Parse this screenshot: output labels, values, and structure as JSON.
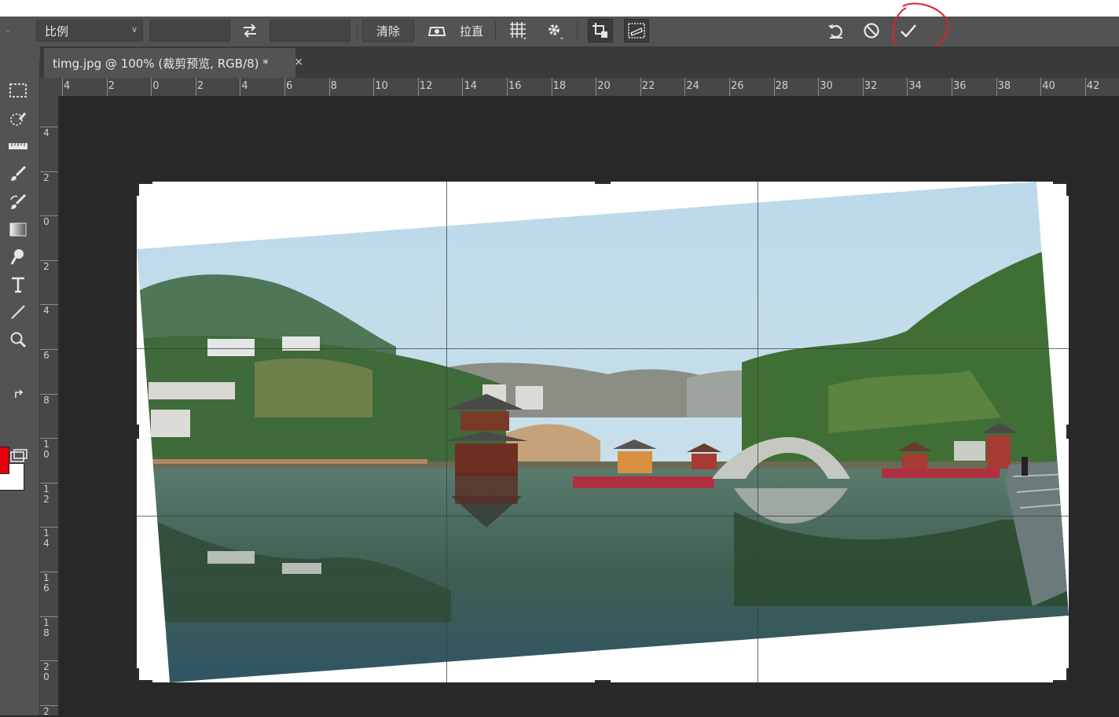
{
  "options_bar": {
    "ratio_label": "比例",
    "clear_label": "清除",
    "straighten_label": "拉直"
  },
  "document_tab": {
    "title": "timg.jpg @ 100% (裁剪预览, RGB/8) *",
    "close_glyph": "×"
  },
  "ruler_h": [
    "4",
    "2",
    "0",
    "2",
    "4",
    "6",
    "8",
    "10",
    "12",
    "14",
    "16",
    "18",
    "20",
    "22",
    "24",
    "26",
    "28",
    "30",
    "32",
    "34",
    "36",
    "38",
    "40",
    "42"
  ],
  "ruler_v": [
    "4",
    "2",
    "0",
    "2",
    "4",
    "6",
    "8",
    "10",
    "12",
    "14",
    "16",
    "18",
    "20",
    "2"
  ],
  "colors": {
    "foreground": "#e8000a",
    "background": "#ffffff",
    "annotation": "#e0202a"
  },
  "icons": [
    "swap-icon",
    "level-icon",
    "grid-overlay-icon",
    "settings-gear-icon",
    "delete-cropped-icon",
    "content-aware-icon",
    "reset-icon",
    "cancel-icon",
    "commit-check-icon"
  ]
}
